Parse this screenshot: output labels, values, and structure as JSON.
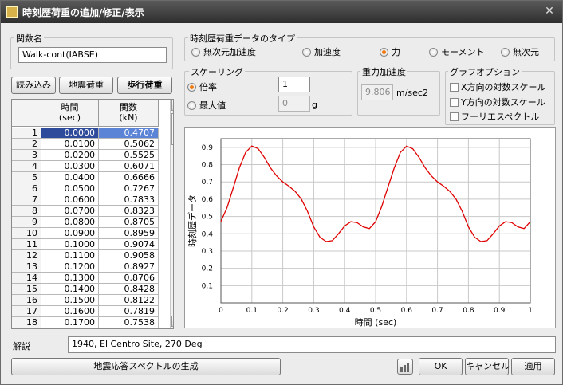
{
  "window": {
    "title": "時刻歴荷重の追加/修正/表示",
    "close_glyph": "✕"
  },
  "func_name": {
    "label": "関数名",
    "value": "Walk-cont(IABSE)"
  },
  "buttons": {
    "load": "読み込み",
    "seismic": "地震荷重",
    "walking": "歩行荷重",
    "generate": "地震応答スペクトルの生成",
    "ok": "OK",
    "cancel": "キャンセル",
    "apply": "適用"
  },
  "data_type": {
    "label": "時刻歴荷重データのタイプ",
    "options": [
      "無次元加速度",
      "加速度",
      "力",
      "モーメント",
      "無次元"
    ],
    "selected": "力"
  },
  "scaling": {
    "label": "スケーリング",
    "factor_label": "倍率",
    "max_label": "最大値",
    "factor_value": "1",
    "max_value": "0",
    "max_unit": "g",
    "selected": "倍率"
  },
  "gravity": {
    "label": "重力加速度",
    "value": "9.806",
    "unit": "m/sec2"
  },
  "graph_options": {
    "label": "グラフオプション",
    "items": [
      "X方向の対数スケール",
      "Y方向の対数スケール",
      "フーリエスペクトル"
    ]
  },
  "table": {
    "col_time": "時間",
    "col_time_unit": "(sec)",
    "col_func": "関数",
    "col_func_unit": "(kN)",
    "rows": [
      [
        "1",
        "0.0000",
        "0.4707"
      ],
      [
        "2",
        "0.0100",
        "0.5062"
      ],
      [
        "3",
        "0.0200",
        "0.5525"
      ],
      [
        "4",
        "0.0300",
        "0.6071"
      ],
      [
        "5",
        "0.0400",
        "0.6666"
      ],
      [
        "6",
        "0.0500",
        "0.7267"
      ],
      [
        "7",
        "0.0600",
        "0.7833"
      ],
      [
        "8",
        "0.0700",
        "0.8323"
      ],
      [
        "9",
        "0.0800",
        "0.8705"
      ],
      [
        "10",
        "0.0900",
        "0.8959"
      ],
      [
        "11",
        "0.1000",
        "0.9074"
      ],
      [
        "12",
        "0.1100",
        "0.9058"
      ],
      [
        "13",
        "0.1200",
        "0.8927"
      ],
      [
        "14",
        "0.1300",
        "0.8706"
      ],
      [
        "15",
        "0.1400",
        "0.8428"
      ],
      [
        "16",
        "0.1500",
        "0.8122"
      ],
      [
        "17",
        "0.1600",
        "0.7819"
      ],
      [
        "18",
        "0.1700",
        "0.7538"
      ]
    ]
  },
  "description": {
    "label": "解説",
    "value": "1940, El Centro Site, 270 Deg"
  },
  "colors": {
    "line": "#e00000",
    "grid": "#c8c8c8",
    "selected_cell": "#2e4a9a",
    "radio_on": "#f07a10"
  },
  "chart_data": {
    "type": "line",
    "xlabel": "時間 (sec)",
    "ylabel": "時刻歴データ",
    "xlim": [
      0,
      1
    ],
    "ylim": [
      0,
      0.95
    ],
    "xticks": [
      "0",
      "0.1",
      "0.2",
      "0.3",
      "0.4",
      "0.5",
      "0.6",
      "0.7",
      "0.8",
      "0.9",
      "1"
    ],
    "yticks": [
      "0.1",
      "0.2",
      "0.3",
      "0.4",
      "0.5",
      "0.6",
      "0.7",
      "0.8",
      "0.9"
    ],
    "grid": true,
    "series": [
      {
        "x": [
          0,
          0.02,
          0.04,
          0.06,
          0.08,
          0.1,
          0.12,
          0.14,
          0.16,
          0.18,
          0.2,
          0.22,
          0.24,
          0.26,
          0.28,
          0.3,
          0.32,
          0.34,
          0.36,
          0.38,
          0.4,
          0.42,
          0.44,
          0.46,
          0.48,
          0.5,
          0.52,
          0.54,
          0.56,
          0.58,
          0.6,
          0.62,
          0.64,
          0.66,
          0.68,
          0.7,
          0.72,
          0.74,
          0.76,
          0.78,
          0.8,
          0.82,
          0.84,
          0.86,
          0.88,
          0.9,
          0.92,
          0.94,
          0.96,
          0.98,
          1.0
        ],
        "y": [
          0.4707,
          0.5525,
          0.6666,
          0.7833,
          0.8705,
          0.9074,
          0.8927,
          0.8428,
          0.7819,
          0.735,
          0.7,
          0.675,
          0.645,
          0.6,
          0.53,
          0.44,
          0.38,
          0.355,
          0.36,
          0.4,
          0.445,
          0.47,
          0.465,
          0.44,
          0.43,
          0.47,
          0.56,
          0.67,
          0.78,
          0.87,
          0.907,
          0.892,
          0.843,
          0.782,
          0.735,
          0.7,
          0.675,
          0.645,
          0.6,
          0.53,
          0.44,
          0.38,
          0.355,
          0.36,
          0.4,
          0.445,
          0.47,
          0.465,
          0.44,
          0.43,
          0.47
        ]
      }
    ]
  }
}
